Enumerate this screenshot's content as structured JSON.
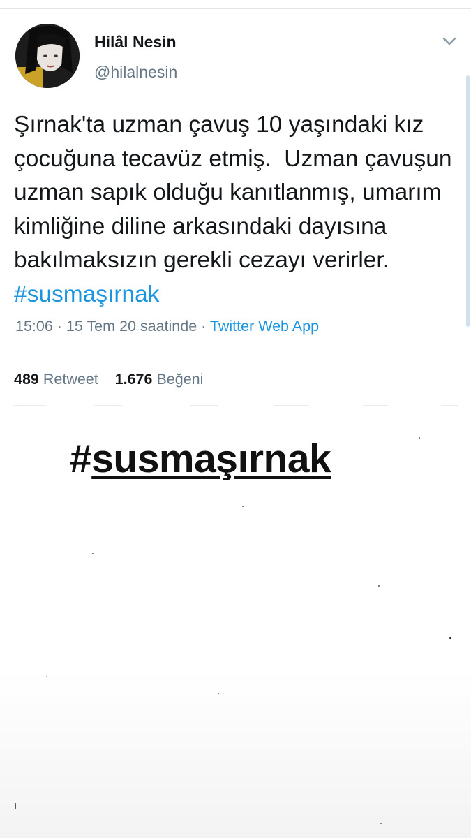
{
  "tweet": {
    "display_name": "Hilâl Nesin",
    "handle": "@hilalnesin",
    "text": "Şırnak'ta uzman çavuş 10 yaşındaki kız çocuğuna tecavüz etmiş.  Uzman çavuşun uzman sapık olduğu kanıtlanmış, umarım kimliğine diline arkasındaki dayısına bakılmaksızın gerekli cezayı verirler. ",
    "hashtag": "#susmaşırnak",
    "time": "15:06 · 15 Tem 20 saatinde · ",
    "source_app": "Twitter Web App",
    "retweet_count": "489",
    "retweet_label": "Retweet",
    "like_count": "1.676",
    "like_label": "Beğeni",
    "menu_icon": "chevron-down-icon",
    "avatar_icon": "profile-photo"
  },
  "overlay": {
    "hash": "#",
    "word": "susmaşırnak"
  },
  "colors": {
    "link": "#1b95e0",
    "muted": "#657786",
    "text": "#14171a"
  }
}
